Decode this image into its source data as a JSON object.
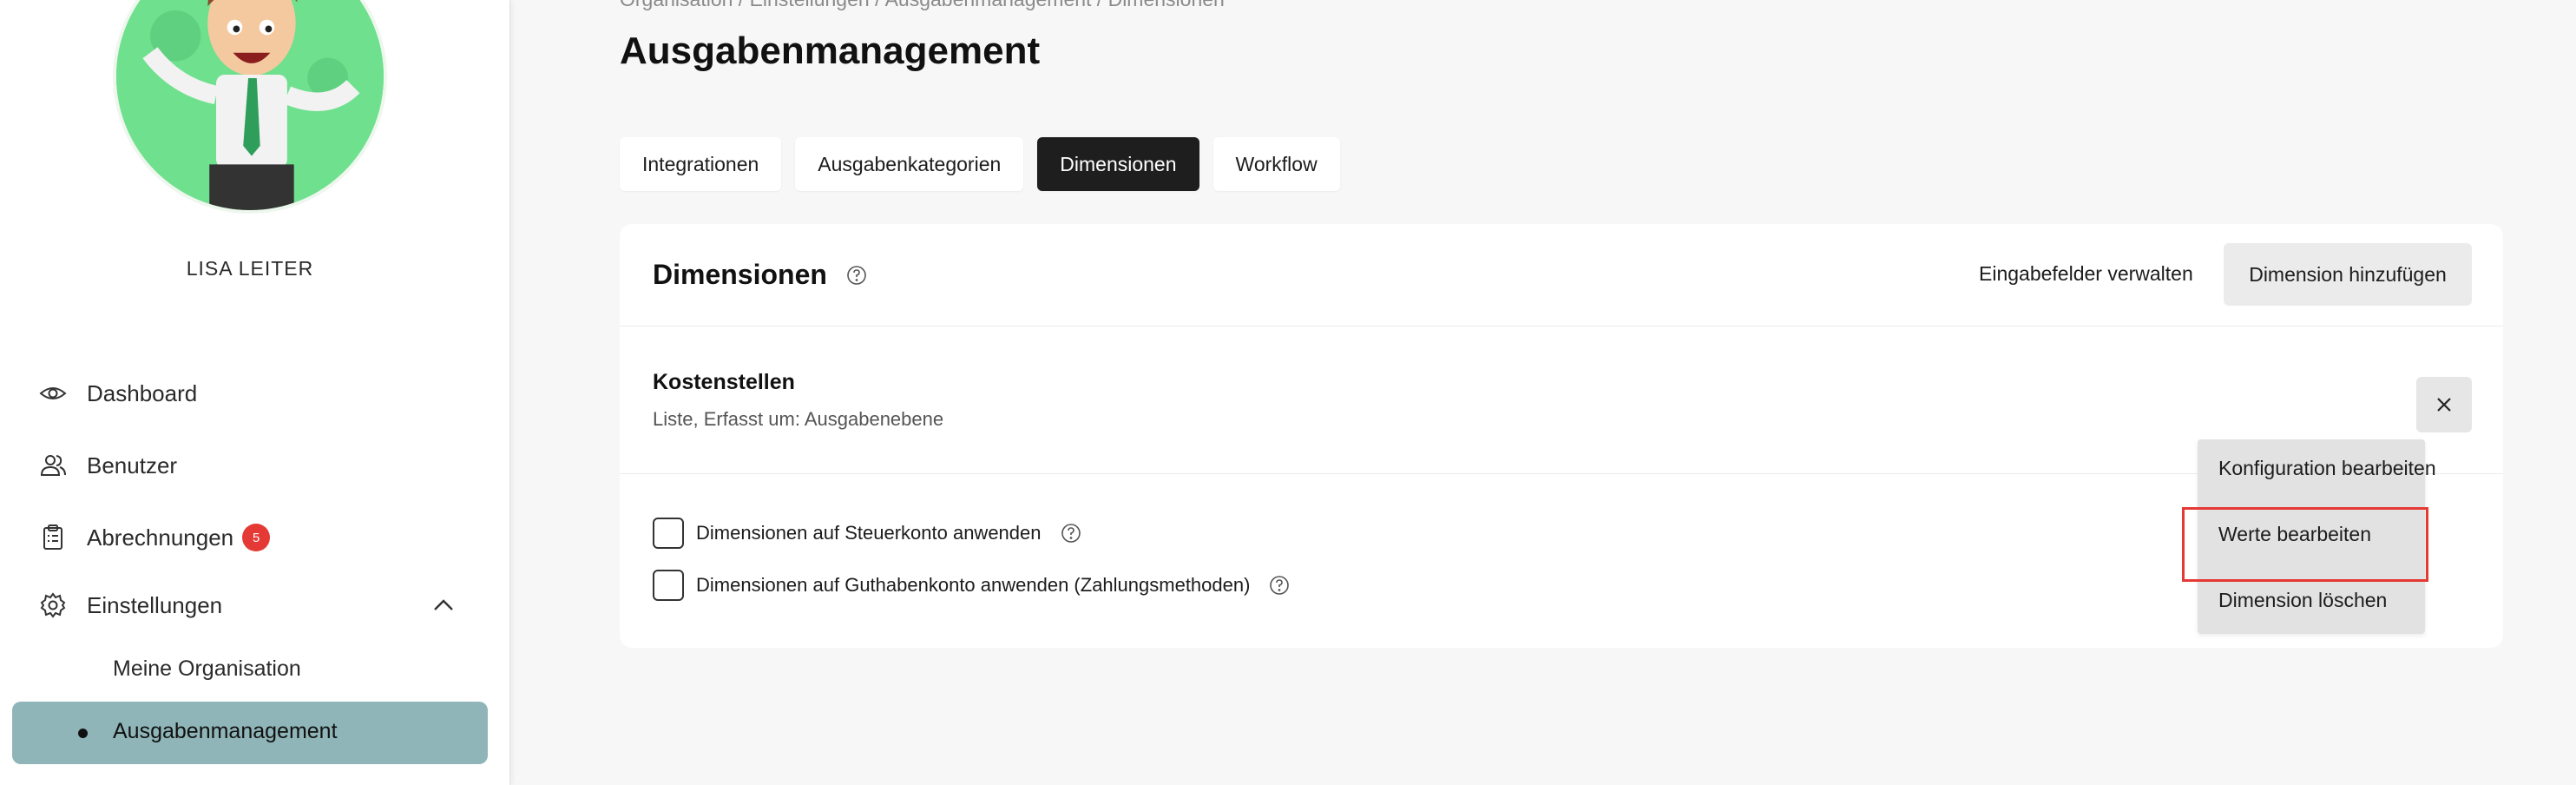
{
  "sidebar": {
    "user_name": "LISA LEITER",
    "nav": {
      "dashboard": "Dashboard",
      "users": "Benutzer",
      "billing": "Abrechnungen",
      "billing_badge": "5",
      "settings": "Einstellungen"
    },
    "sub": {
      "my_org": "Meine Organisation",
      "expense_mgmt": "Ausgabenmanagement"
    }
  },
  "main": {
    "breadcrumb": "Organisation / Einstellungen / Ausgabenmanagement / Dimensionen",
    "title": "Ausgabenmanagement",
    "tabs": [
      {
        "label": "Integrationen"
      },
      {
        "label": "Ausgabenkategorien"
      },
      {
        "label": "Dimensionen"
      },
      {
        "label": "Workflow"
      }
    ],
    "card": {
      "title": "Dimensionen",
      "manage_link": "Eingabefelder verwalten",
      "add_button": "Dimension hinzufügen",
      "dimension": {
        "name": "Kostenstellen",
        "description": "Liste, Erfasst um: Ausgabenebene"
      },
      "checks": [
        {
          "label": "Dimensionen auf Steuerkonto anwenden"
        },
        {
          "label": "Dimensionen auf Guthabenkonto anwenden (Zahlungsmethoden)"
        }
      ]
    },
    "dropdown": {
      "items": [
        {
          "label": "Konfiguration bearbeiten"
        },
        {
          "label": "Werte bearbeiten"
        },
        {
          "label": "Dimension löschen"
        }
      ]
    }
  },
  "colors": {
    "accent_dark": "#1e1e1e",
    "active_sidebar": "#8fb5b8",
    "badge_red": "#e53935",
    "highlight_red": "#e53935",
    "avatar_green": "#6fe08e"
  }
}
